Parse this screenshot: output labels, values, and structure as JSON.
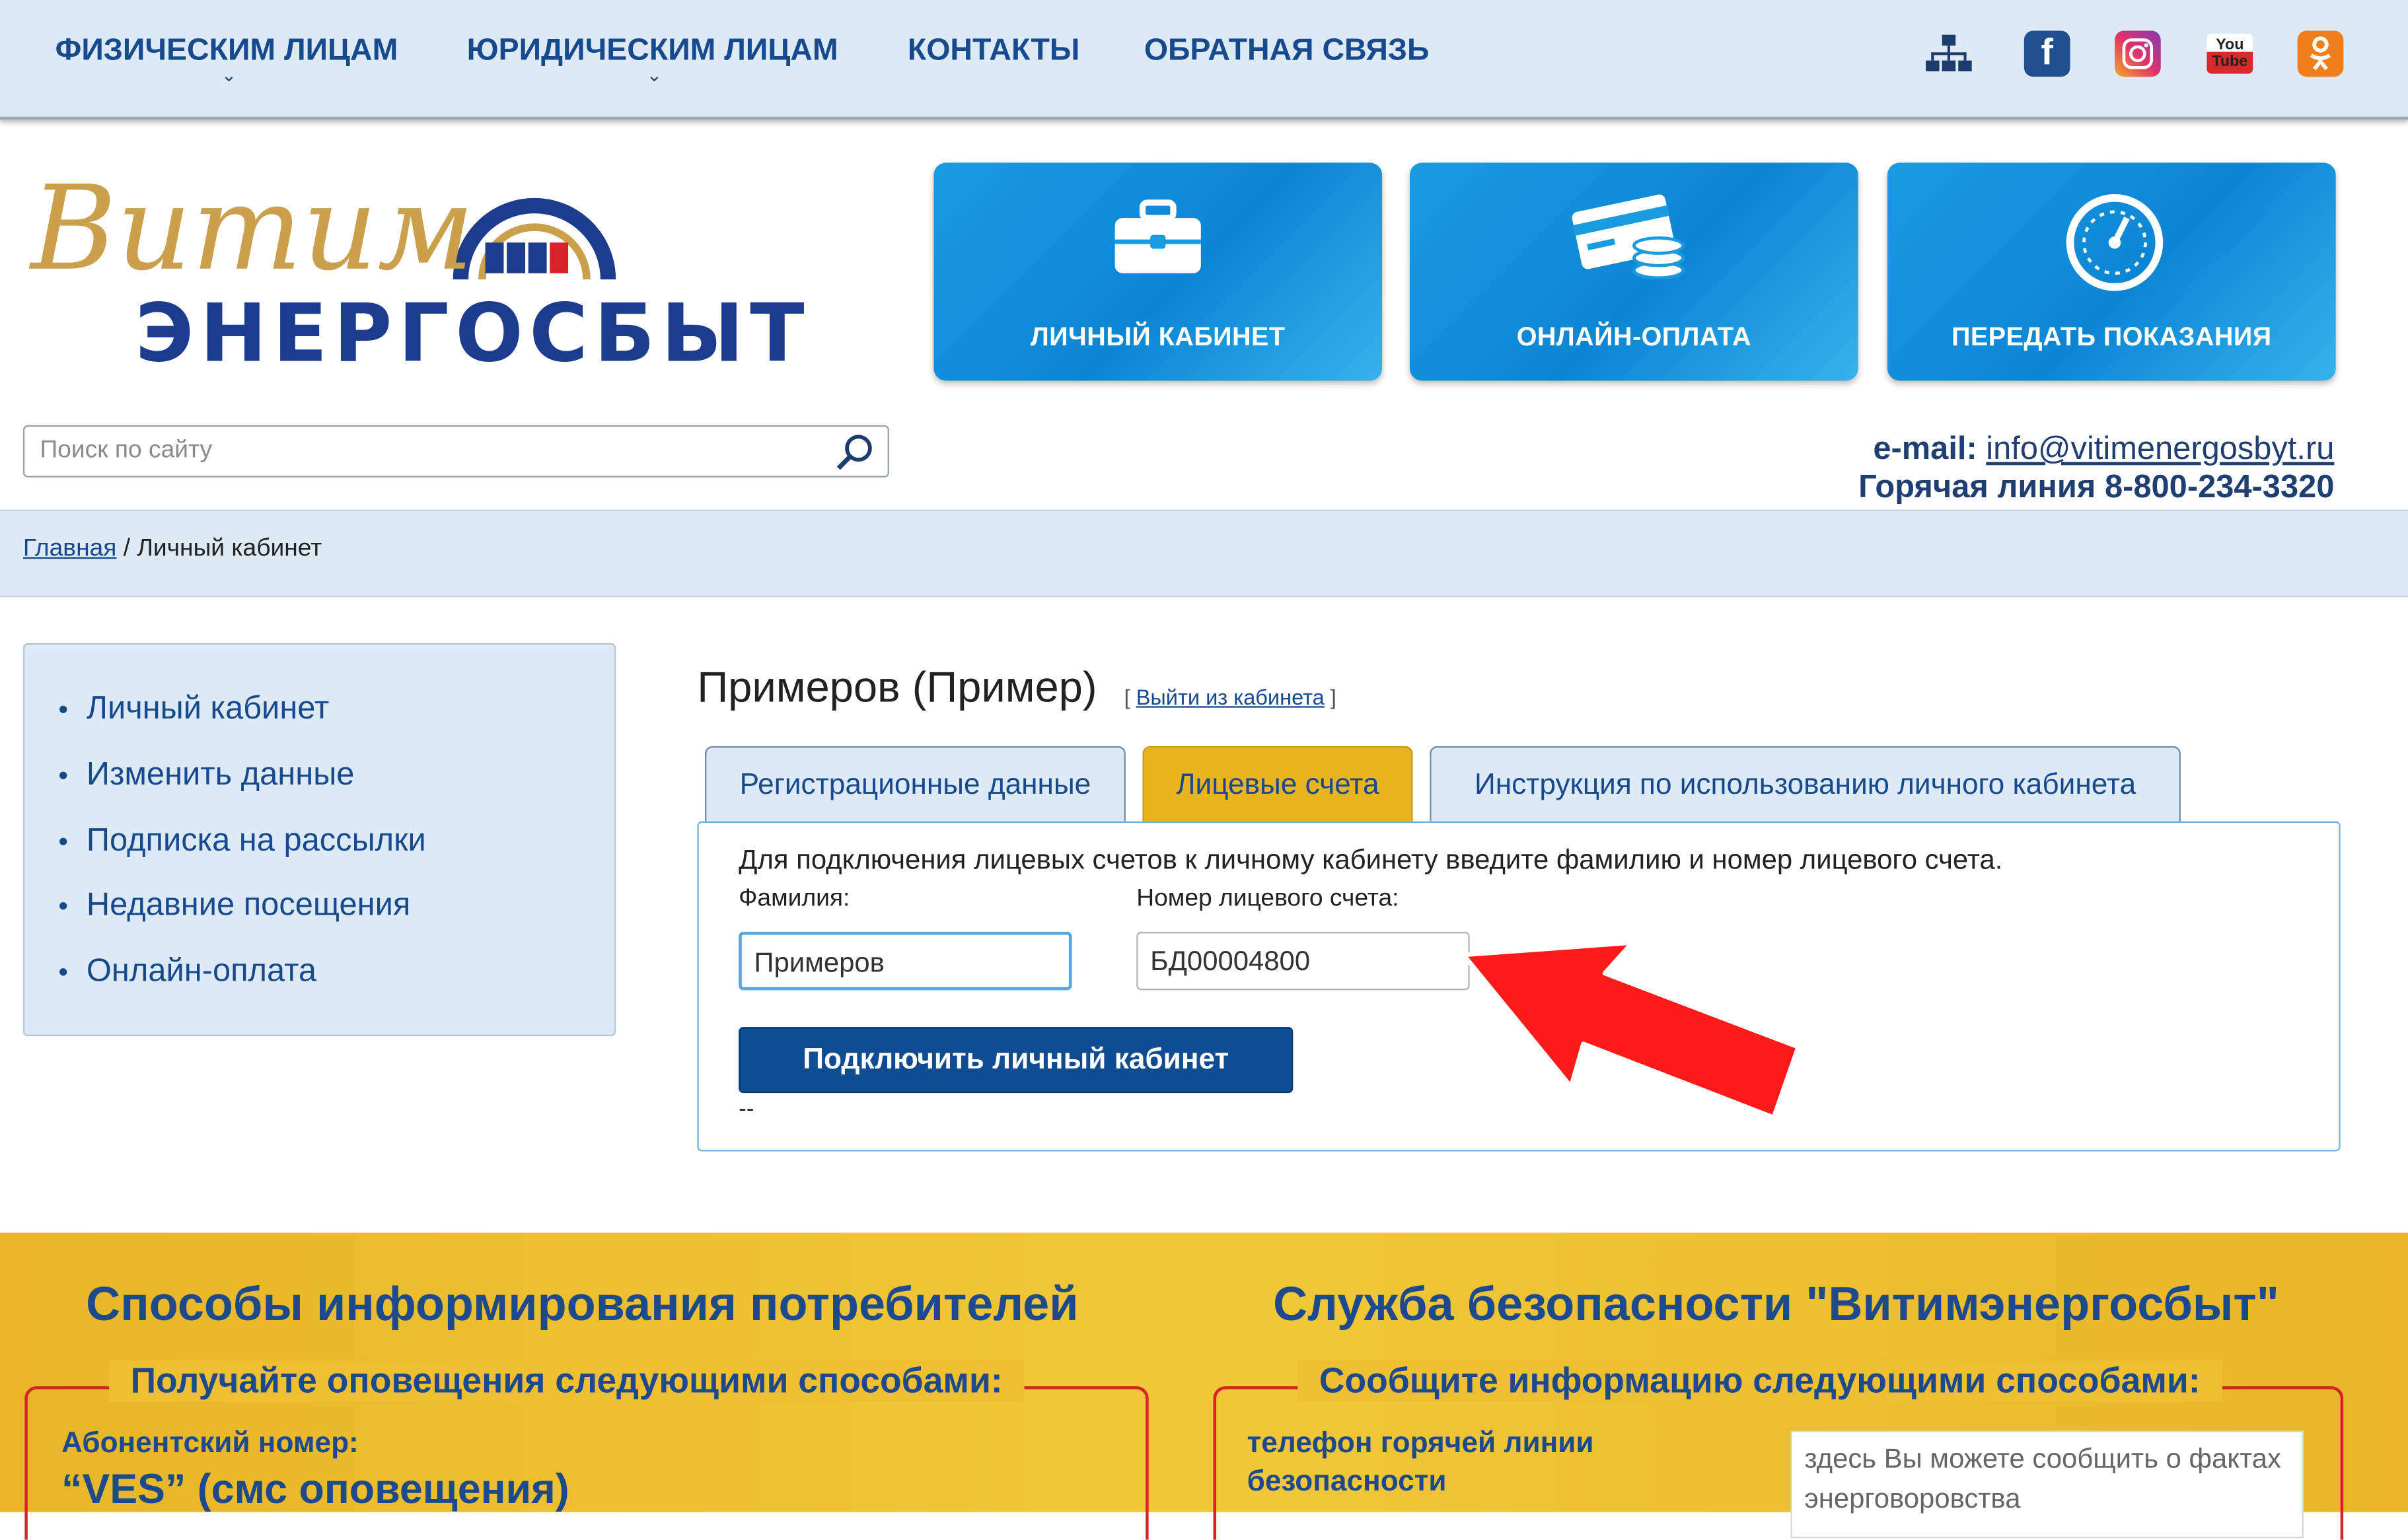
{
  "top_nav": {
    "items": [
      {
        "label": "ФИЗИЧЕСКИМ ЛИЦАМ",
        "has_submenu": true
      },
      {
        "label": "ЮРИДИЧЕСКИМ ЛИЦАМ",
        "has_submenu": true
      },
      {
        "label": "КОНТАКТЫ",
        "has_submenu": false
      },
      {
        "label": "ОБРАТНАЯ СВЯЗЬ",
        "has_submenu": false
      }
    ],
    "chevron": "⌄",
    "social_icons": [
      "sitemap-icon",
      "facebook-icon",
      "instagram-icon",
      "youtube-icon",
      "odnoklassniki-icon"
    ],
    "social_glyphs": {
      "facebook": "f",
      "youtube": "You Tube"
    }
  },
  "logo": {
    "script_text": "Витим",
    "word_text": "ЭНЕРГОСБЫТ"
  },
  "tiles": [
    {
      "label": "ЛИЧНЫЙ КАБИНЕТ",
      "icon": "briefcase-icon"
    },
    {
      "label": "ОНЛАЙН-ОПЛАТА",
      "icon": "card-coins-icon"
    },
    {
      "label": "ПЕРЕДАТЬ ПОКАЗАНИЯ",
      "icon": "meter-gauge-icon"
    }
  ],
  "search": {
    "placeholder": "Поиск по сайту",
    "icon": "search-icon"
  },
  "contacts": {
    "email_label": "e-mail:",
    "email": "info@vitimenergosbyt.ru",
    "hotline_label": "Горячая линия",
    "hotline": "8-800-234-3320"
  },
  "breadcrumb": {
    "home": "Главная",
    "separator": " / ",
    "current": "Личный кабинет"
  },
  "sidebar": {
    "items": [
      "Личный кабинет",
      "Изменить данные",
      "Подписка на рассылки",
      "Недавние посещения",
      "Онлайн-оплата"
    ]
  },
  "main": {
    "user_name": "Примеров (Пример)",
    "logout_open": "[",
    "logout_label": "Выйти из кабинета",
    "logout_close": "]",
    "tabs": [
      {
        "label": "Регистрационные данные",
        "active": false
      },
      {
        "label": "Лицевые счета",
        "active": true
      },
      {
        "label": "Инструкция по использованию личного кабинета",
        "active": false
      }
    ],
    "instruction": "Для подключения лицевых счетов к личному кабинету введите фамилию и номер лицевого счета.",
    "surname_label": "Фамилия:",
    "surname_value": "Примеров",
    "account_label": "Номер лицевого счета:",
    "account_value": "БД00004800",
    "submit_label": "Подключить личный кабинет",
    "footer_text": "--"
  },
  "annotation": {
    "arrow_color": "#ff1a1a"
  },
  "bottom": {
    "left": {
      "heading": "Способы информирования потребителей",
      "subheading": "Получайте оповещения следующими способами:",
      "line1": "Абонентский номер:",
      "line2": "“VES” (смс оповещения)"
    },
    "right": {
      "heading": "Служба безопасности \"Витимэнергосбыт\"",
      "subheading": "Сообщите информацию следующими способами:",
      "line1": "телефон горячей линии",
      "line2": "безопасности",
      "note": "здесь Вы можете сообщить о фактах энерговоровства"
    }
  },
  "colors": {
    "brand_blue": "#17498f",
    "accent_yellow": "#e8b51f",
    "tile_blue": "#1a9be0",
    "alert_red": "#d6232a"
  }
}
